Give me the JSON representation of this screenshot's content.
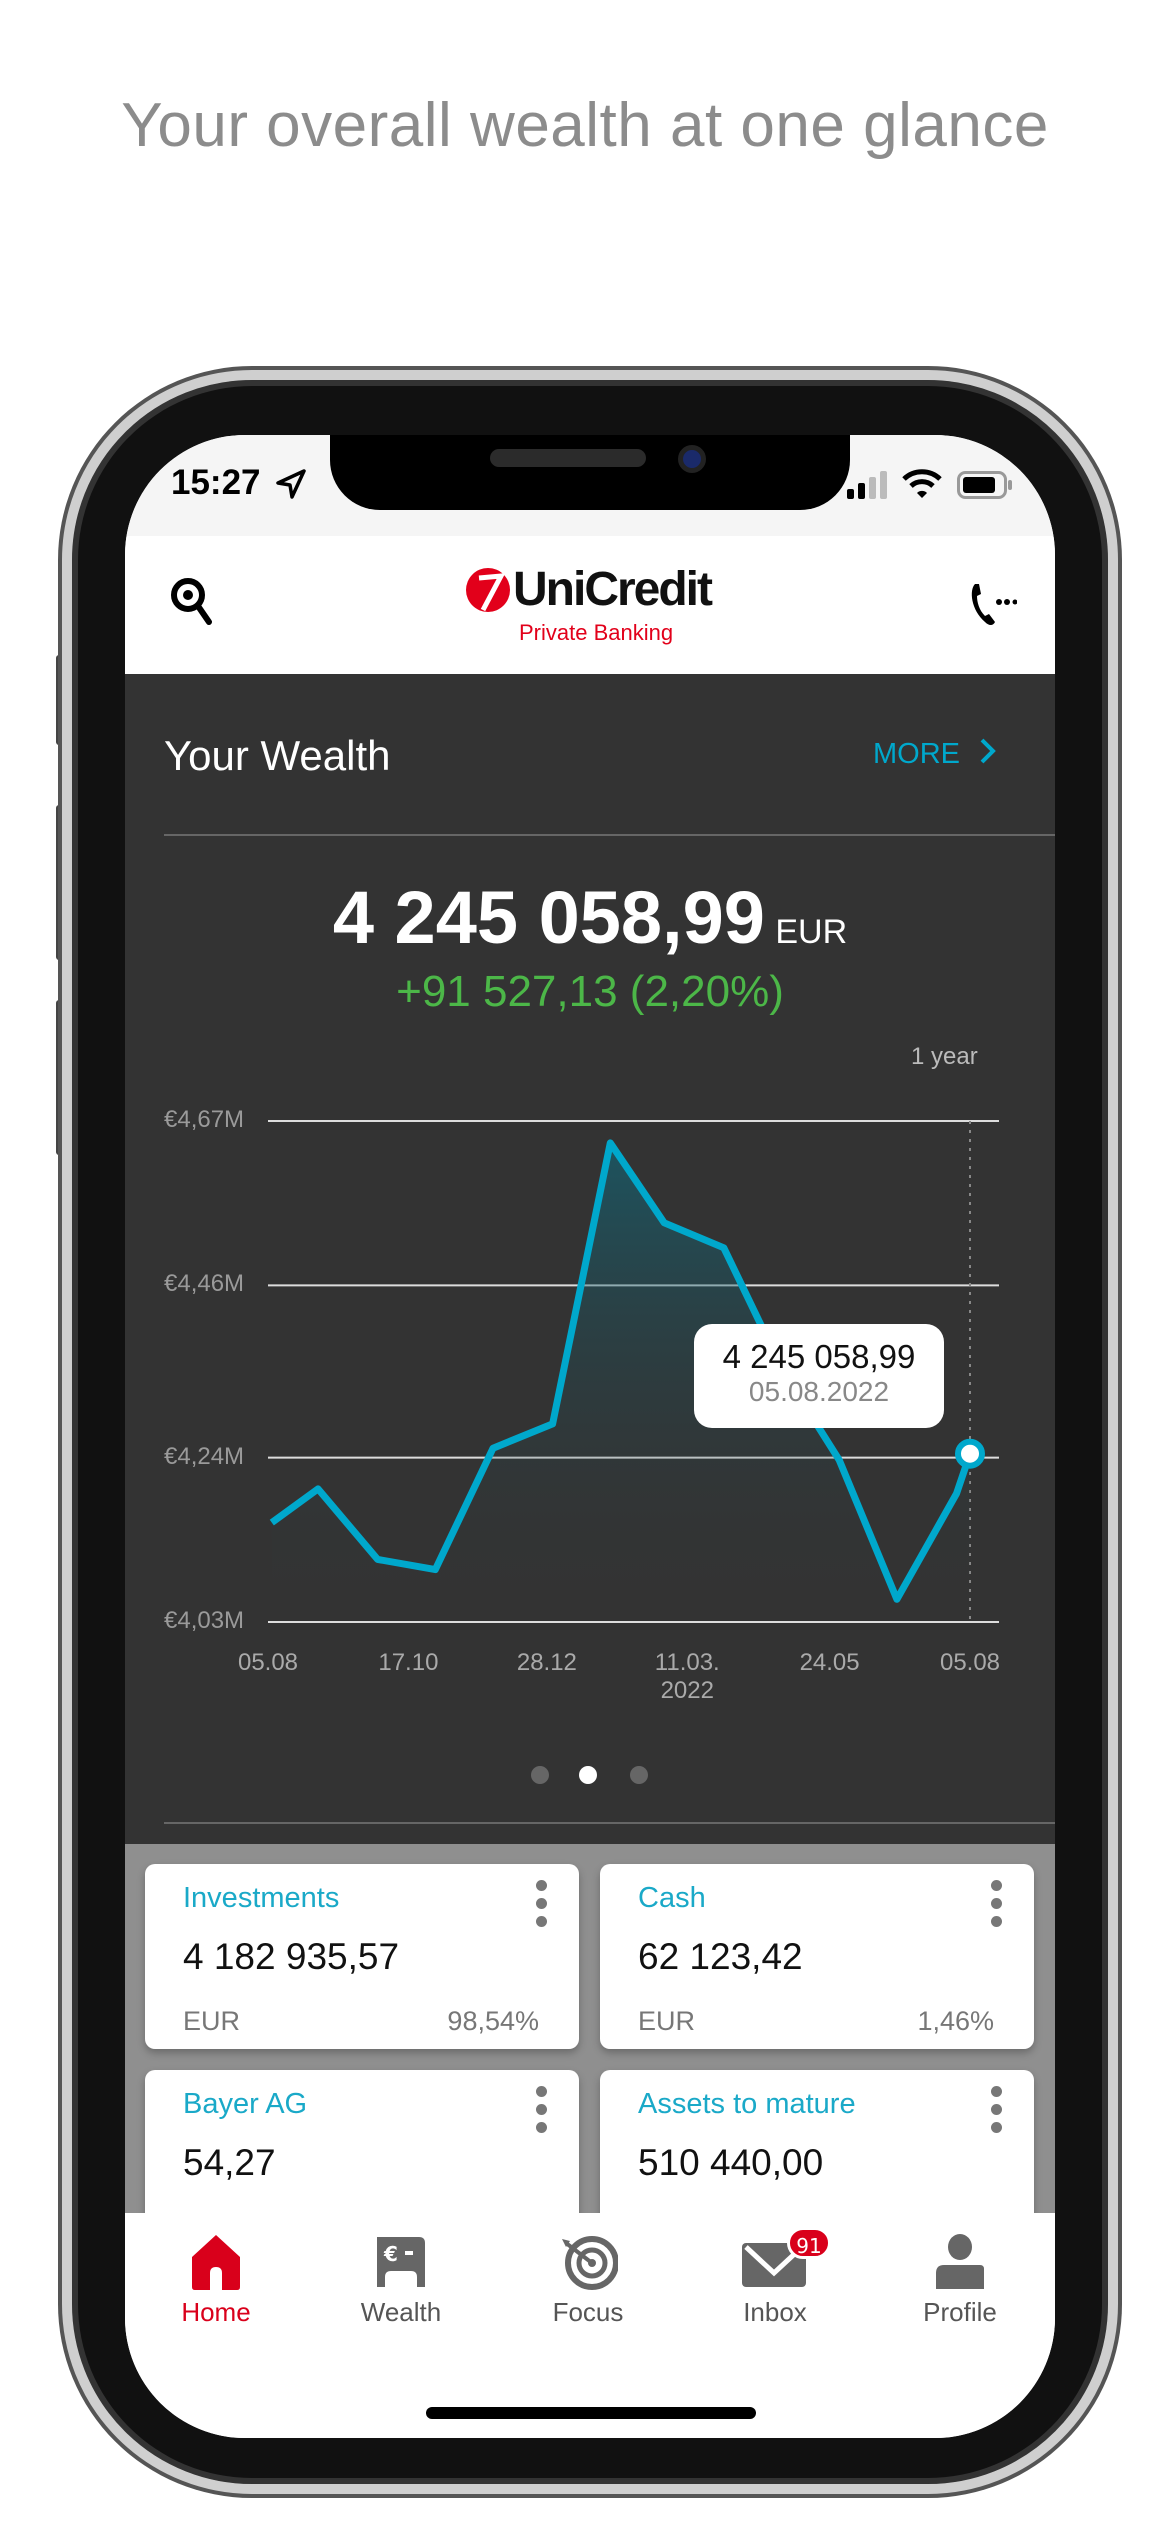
{
  "headline": "Your overall wealth at one glance",
  "status_bar": {
    "time": "15:27",
    "icons": [
      "location-arrow-icon",
      "signal-icon",
      "wifi-icon",
      "battery-icon"
    ]
  },
  "header": {
    "logo_name": "UniCredit",
    "logo_sub": "Private Banking",
    "left_icon": "search-icon",
    "right_icon": "phone-icon",
    "brand_color": "#e2001a"
  },
  "wealth": {
    "title": "Your Wealth",
    "more_label": "MORE",
    "total": "4 245 058,99",
    "currency": "EUR",
    "change": "+91 527,13 (2,20%)",
    "period": "1 year",
    "accent_color": "#00a8cc",
    "positive_color": "#4cb748",
    "page_dots": {
      "count": 3,
      "active": 2
    }
  },
  "chart_data": {
    "type": "area",
    "ylabel_unit": "EUR (millions)",
    "y_ticks": [
      "€4,67M",
      "€4,46M",
      "€4,24M",
      "€4,03M"
    ],
    "y_tick_values": [
      4.67,
      4.46,
      4.24,
      4.03
    ],
    "ylim": [
      4.03,
      4.67
    ],
    "x_ticks": [
      {
        "label": "05.08",
        "sub": "",
        "date": "2021-08-05"
      },
      {
        "label": "17.10",
        "sub": "",
        "date": "2021-10-17"
      },
      {
        "label": "28.12",
        "sub": "",
        "date": "2021-12-28"
      },
      {
        "label": "11.03.",
        "sub": "2022",
        "date": "2022-03-11"
      },
      {
        "label": "24.05",
        "sub": "",
        "date": "2022-05-24"
      },
      {
        "label": "05.08",
        "sub": "",
        "date": "2022-08-05"
      }
    ],
    "xlim": [
      "2021-08-05",
      "2022-08-05"
    ],
    "grid": "horizontal",
    "line_color": "#00a8cc",
    "points": [
      {
        "x": "2021-08-07",
        "y": 4.157
      },
      {
        "x": "2021-08-31",
        "y": 4.2
      },
      {
        "x": "2021-10-01",
        "y": 4.11
      },
      {
        "x": "2021-10-31",
        "y": 4.097
      },
      {
        "x": "2021-11-30",
        "y": 4.252
      },
      {
        "x": "2021-12-31",
        "y": 4.283
      },
      {
        "x": "2022-01-30",
        "y": 4.642
      },
      {
        "x": "2022-02-27",
        "y": 4.54
      },
      {
        "x": "2022-03-30",
        "y": 4.508
      },
      {
        "x": "2022-04-30",
        "y": 4.35
      },
      {
        "x": "2022-05-29",
        "y": 4.237
      },
      {
        "x": "2022-06-28",
        "y": 4.059
      },
      {
        "x": "2022-07-29",
        "y": 4.194
      },
      {
        "x": "2022-08-05",
        "y": 4.245
      }
    ],
    "tooltip": {
      "value": "4 245 058,99",
      "date": "05.08.2022"
    }
  },
  "cards": [
    {
      "title": "Investments",
      "value": "4 182 935,57",
      "currency": "EUR",
      "percent": "98,54%"
    },
    {
      "title": "Cash",
      "value": "62 123,42",
      "currency": "EUR",
      "percent": "1,46%"
    },
    {
      "title": "Bayer AG",
      "value": "54,27"
    },
    {
      "title": "Assets to mature",
      "value": "510 440,00"
    }
  ],
  "tabs": [
    {
      "label": "Home",
      "icon": "home-icon",
      "active": true
    },
    {
      "label": "Wealth",
      "icon": "wealth-icon"
    },
    {
      "label": "Focus",
      "icon": "target-icon"
    },
    {
      "label": "Inbox",
      "icon": "mail-icon",
      "badge": "91"
    },
    {
      "label": "Profile",
      "icon": "person-icon"
    }
  ]
}
